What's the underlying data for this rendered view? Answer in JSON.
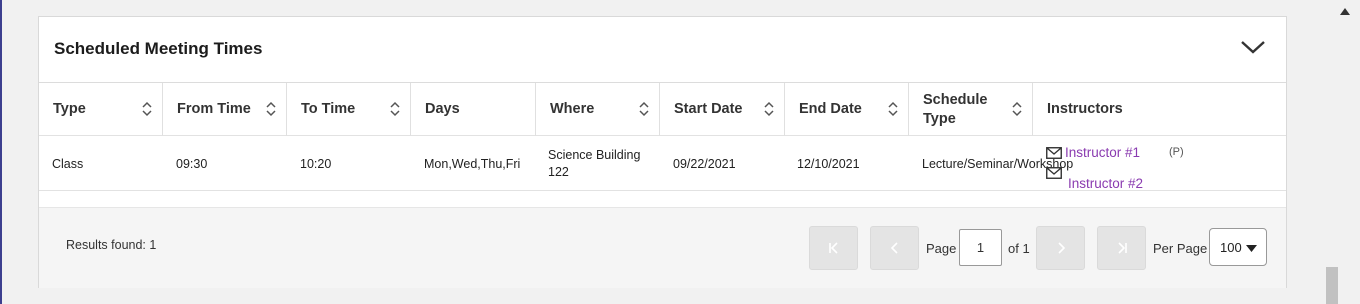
{
  "panel": {
    "title": "Scheduled Meeting Times",
    "collapse_icon": "chevron-down-icon"
  },
  "table": {
    "columns": [
      {
        "label": "Type",
        "sortable": true
      },
      {
        "label": "From Time",
        "sortable": true
      },
      {
        "label": "To Time",
        "sortable": true
      },
      {
        "label": "Days",
        "sortable": false
      },
      {
        "label": "Where",
        "sortable": true
      },
      {
        "label": "Start Date",
        "sortable": true
      },
      {
        "label": "End Date",
        "sortable": true
      },
      {
        "label": "Schedule Type",
        "sortable": true
      },
      {
        "label": "Instructors",
        "sortable": false
      }
    ],
    "rows": [
      {
        "type": "Class",
        "from_time": "09:30",
        "to_time": "10:20",
        "days": "Mon,Wed,Thu,Fri",
        "where": "Science Building 122",
        "start_date": "09/22/2021",
        "end_date": "12/10/2021",
        "schedule_type": "Lecture/Seminar/Workshop",
        "instructors": [
          {
            "name": "Instructor #1",
            "tag": "(P)"
          },
          {
            "name": "Instructor #2",
            "tag": ""
          }
        ]
      }
    ]
  },
  "footer": {
    "results_label": "Results found: 1",
    "page_label": "Page",
    "page_value": "1",
    "of_label": "of 1",
    "per_page_label": "Per Page",
    "per_page_value": "100"
  },
  "colors": {
    "link": "#8a3bb0",
    "pager_button": "#e4e4e4"
  }
}
